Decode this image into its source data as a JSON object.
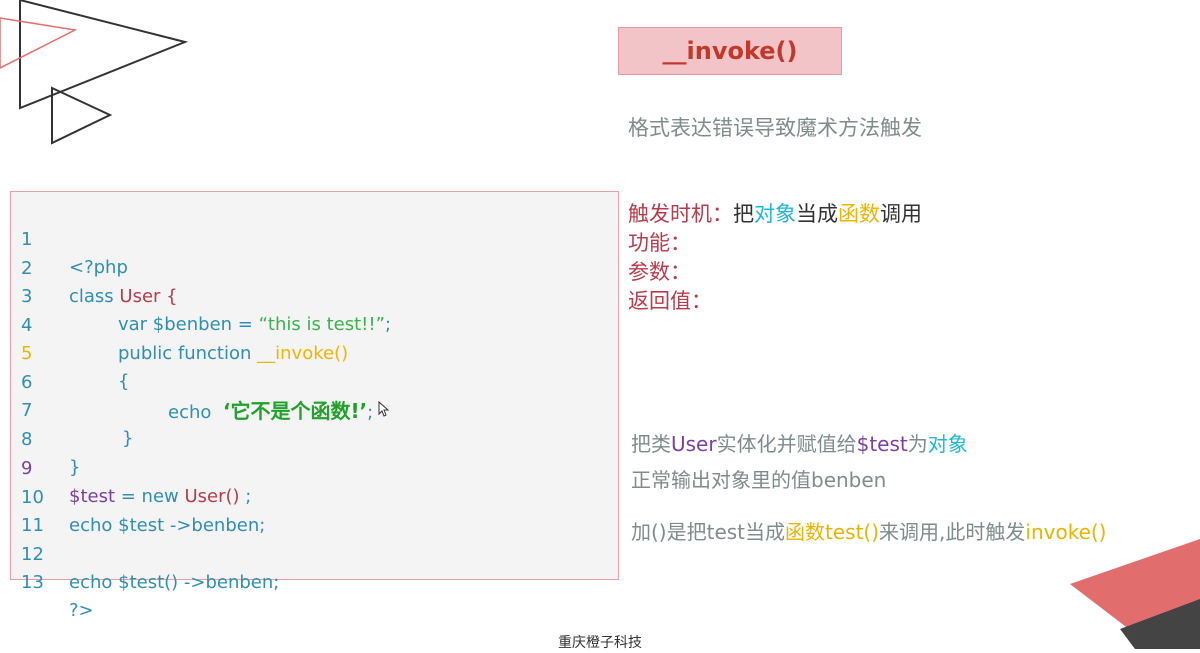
{
  "title": "__invoke()",
  "subtitle": "格式表达错误导致魔术方法触发",
  "code": {
    "lines": [
      {
        "n": "1",
        "segments": [
          "<?php"
        ]
      },
      {
        "n": "2",
        "segments": [
          "class ",
          "User {"
        ]
      },
      {
        "n": "3",
        "segments": [
          "var $benben = ",
          "“this is test!!”",
          ";"
        ]
      },
      {
        "n": "4",
        "segments": [
          "public function ",
          "__invoke()"
        ]
      },
      {
        "n": "5",
        "segments": [
          "{"
        ]
      },
      {
        "n": "6",
        "segments": [
          "echo  ",
          "‘它不是个函数!’",
          ";"
        ]
      },
      {
        "n": "7",
        "segments": [
          "}"
        ]
      },
      {
        "n": "8",
        "segments": [
          "}"
        ]
      },
      {
        "n": "9",
        "segments": [
          "$test",
          " = new ",
          "User()",
          " ;"
        ]
      },
      {
        "n": "10",
        "segments": [
          "echo $test ->benben;"
        ]
      },
      {
        "n": "11",
        "segments": [
          ""
        ]
      },
      {
        "n": "12",
        "segments": [
          "echo $test() ->benben;"
        ]
      },
      {
        "n": "13",
        "segments": [
          "?>"
        ]
      }
    ]
  },
  "info": {
    "trigger_label": "触发时机：",
    "trigger_parts": [
      "把",
      "对象",
      "当成",
      "函数",
      "调用"
    ],
    "function_label": "功能：",
    "params_label": "参数：",
    "return_label": "返回值："
  },
  "notes": {
    "n1": [
      "把类",
      "User",
      "实体化并赋值给",
      "$test",
      "为",
      "对象"
    ],
    "n2": "正常输出对象里的值benben",
    "n3": [
      "加()是把test当成",
      "函数",
      "test()",
      "来调用,此时触发",
      "invoke()"
    ]
  },
  "footer": "重庆橙子科技",
  "colors": {
    "accent_red": "#b83b4a",
    "code_blue": "#2f8fb3",
    "string_green": "#3bb24a",
    "highlight_gold": "#f0b400",
    "highlight_cyan": "#1fb7d6",
    "variable_purple": "#7b3fa0",
    "title_bg": "#f2c4c7"
  }
}
